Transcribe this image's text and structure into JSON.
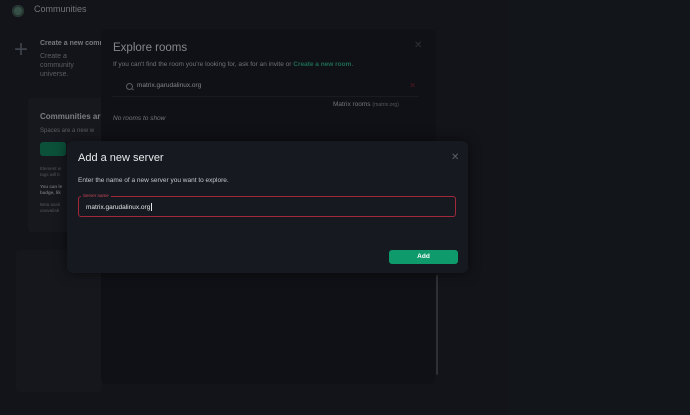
{
  "background": {
    "app_title": "Communities",
    "create_title": "Create a new commu",
    "create_desc": "Create a community universe.",
    "card_title": "Communities ar",
    "card_desc": "Spaces are a new w",
    "note_1": "Element w tags will b",
    "note_2": "You can le badge, lik",
    "note_3": "Beta avail unavailab"
  },
  "explore": {
    "title": "Explore rooms",
    "desc_prefix": "If you can't find the room you're looking for, ask for an invite or ",
    "desc_link": "Create a new room",
    "desc_suffix": ".",
    "search_value": "matrix.garudalinux.org",
    "server_label": "Matrix rooms",
    "server_sub": "(matrix.org)",
    "empty_text": "No rooms to show",
    "close_glyph": "✕",
    "clear_glyph": "✕"
  },
  "add_server": {
    "title": "Add a new server",
    "close_glyph": "✕",
    "description": "Enter the name of a new server you want to explore.",
    "field_label": "Server name",
    "field_value": "matrix.garudalinux.org",
    "add_label": "Add"
  },
  "colors": {
    "accent": "#0f9a6b",
    "link": "#2ebc8a",
    "error_border": "#a0283a",
    "background": "#1b1e26"
  }
}
